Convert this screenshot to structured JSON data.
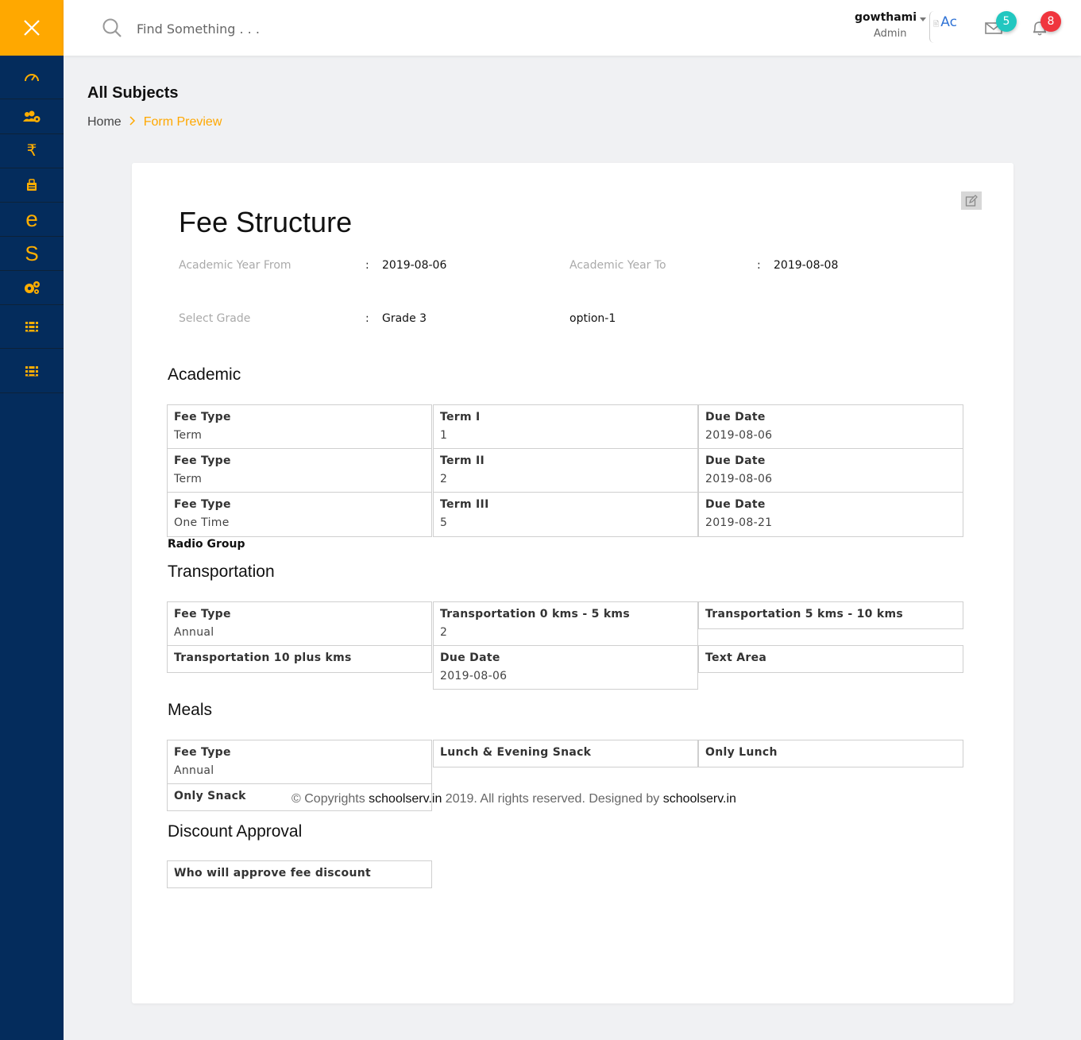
{
  "sidebar": {
    "close_icon": "close-icon",
    "items": [
      {
        "name": "dashboard-icon",
        "glyph": ""
      },
      {
        "name": "users-cog-icon",
        "glyph": ""
      },
      {
        "name": "rupee-icon",
        "glyph": "₹"
      },
      {
        "name": "briefcase-icon",
        "glyph": ""
      },
      {
        "name": "letter-e-icon",
        "glyph": "e"
      },
      {
        "name": "letter-s-icon",
        "glyph": "S"
      },
      {
        "name": "cogs-icon",
        "glyph": ""
      },
      {
        "name": "layers-icon",
        "glyph": ""
      },
      {
        "name": "layers-icon",
        "glyph": ""
      }
    ],
    "colors": {
      "background": "#042c5c",
      "accent": "#ffa800"
    }
  },
  "header": {
    "search_placeholder": "Find Something . . .",
    "user_name": "gowthami",
    "user_role": "Admin",
    "avatar_text": "Ac",
    "mail_count": "5",
    "notification_count": "8"
  },
  "page": {
    "title": "All Subjects",
    "breadcrumb": {
      "home": "Home",
      "separator": ">",
      "current": "Form Preview"
    }
  },
  "form": {
    "title": "Fee Structure",
    "academic_year_from_label": "Academic Year From",
    "academic_year_from_value": "2019-08-06",
    "academic_year_to_label": "Academic Year To",
    "academic_year_to_value": "2019-08-08",
    "grade_label": "Select Grade",
    "grade_value": "Grade 3",
    "option_value": "option-1",
    "colon": ":",
    "radio_group_label": "Radio Group"
  },
  "sections": {
    "academic": {
      "title": "Academic",
      "rows": [
        [
          {
            "label": "Fee Type",
            "value": "Term"
          },
          {
            "label": "Term I",
            "value": "1"
          },
          {
            "label": "Due Date",
            "value": "2019-08-06"
          }
        ],
        [
          {
            "label": "Fee Type",
            "value": "Term"
          },
          {
            "label": "Term II",
            "value": "2"
          },
          {
            "label": "Due Date",
            "value": "2019-08-06"
          }
        ],
        [
          {
            "label": "Fee Type",
            "value": "One Time"
          },
          {
            "label": "Term III",
            "value": "5"
          },
          {
            "label": "Due Date",
            "value": "2019-08-21"
          }
        ]
      ]
    },
    "transportation": {
      "title": "Transportation",
      "rows": [
        [
          {
            "label": "Fee Type",
            "value": "Annual"
          },
          {
            "label": "Transportation 0 kms - 5 kms",
            "value": "2"
          },
          {
            "label": "Transportation 5 kms - 10 kms"
          }
        ],
        [
          {
            "label": "Transportation 10 plus kms"
          },
          {
            "label": "Due Date",
            "value": "2019-08-06"
          },
          {
            "label": "Text Area"
          }
        ]
      ]
    },
    "meals": {
      "title": "Meals",
      "rows": [
        [
          {
            "label": "Fee Type",
            "value": "Annual"
          },
          {
            "label": "Lunch & Evening Snack"
          },
          {
            "label": "Only Lunch"
          }
        ],
        [
          {
            "label": "Only Snack"
          }
        ]
      ]
    },
    "discount": {
      "title": "Discount Approval",
      "rows": [
        [
          {
            "label": "Who will approve fee discount"
          }
        ]
      ]
    }
  },
  "footer": {
    "prefix": "© Copyrights ",
    "link1": "schoolserv.in",
    "middle": " 2019. All rights reserved. Designed by ",
    "link2": "schoolserv.in"
  }
}
